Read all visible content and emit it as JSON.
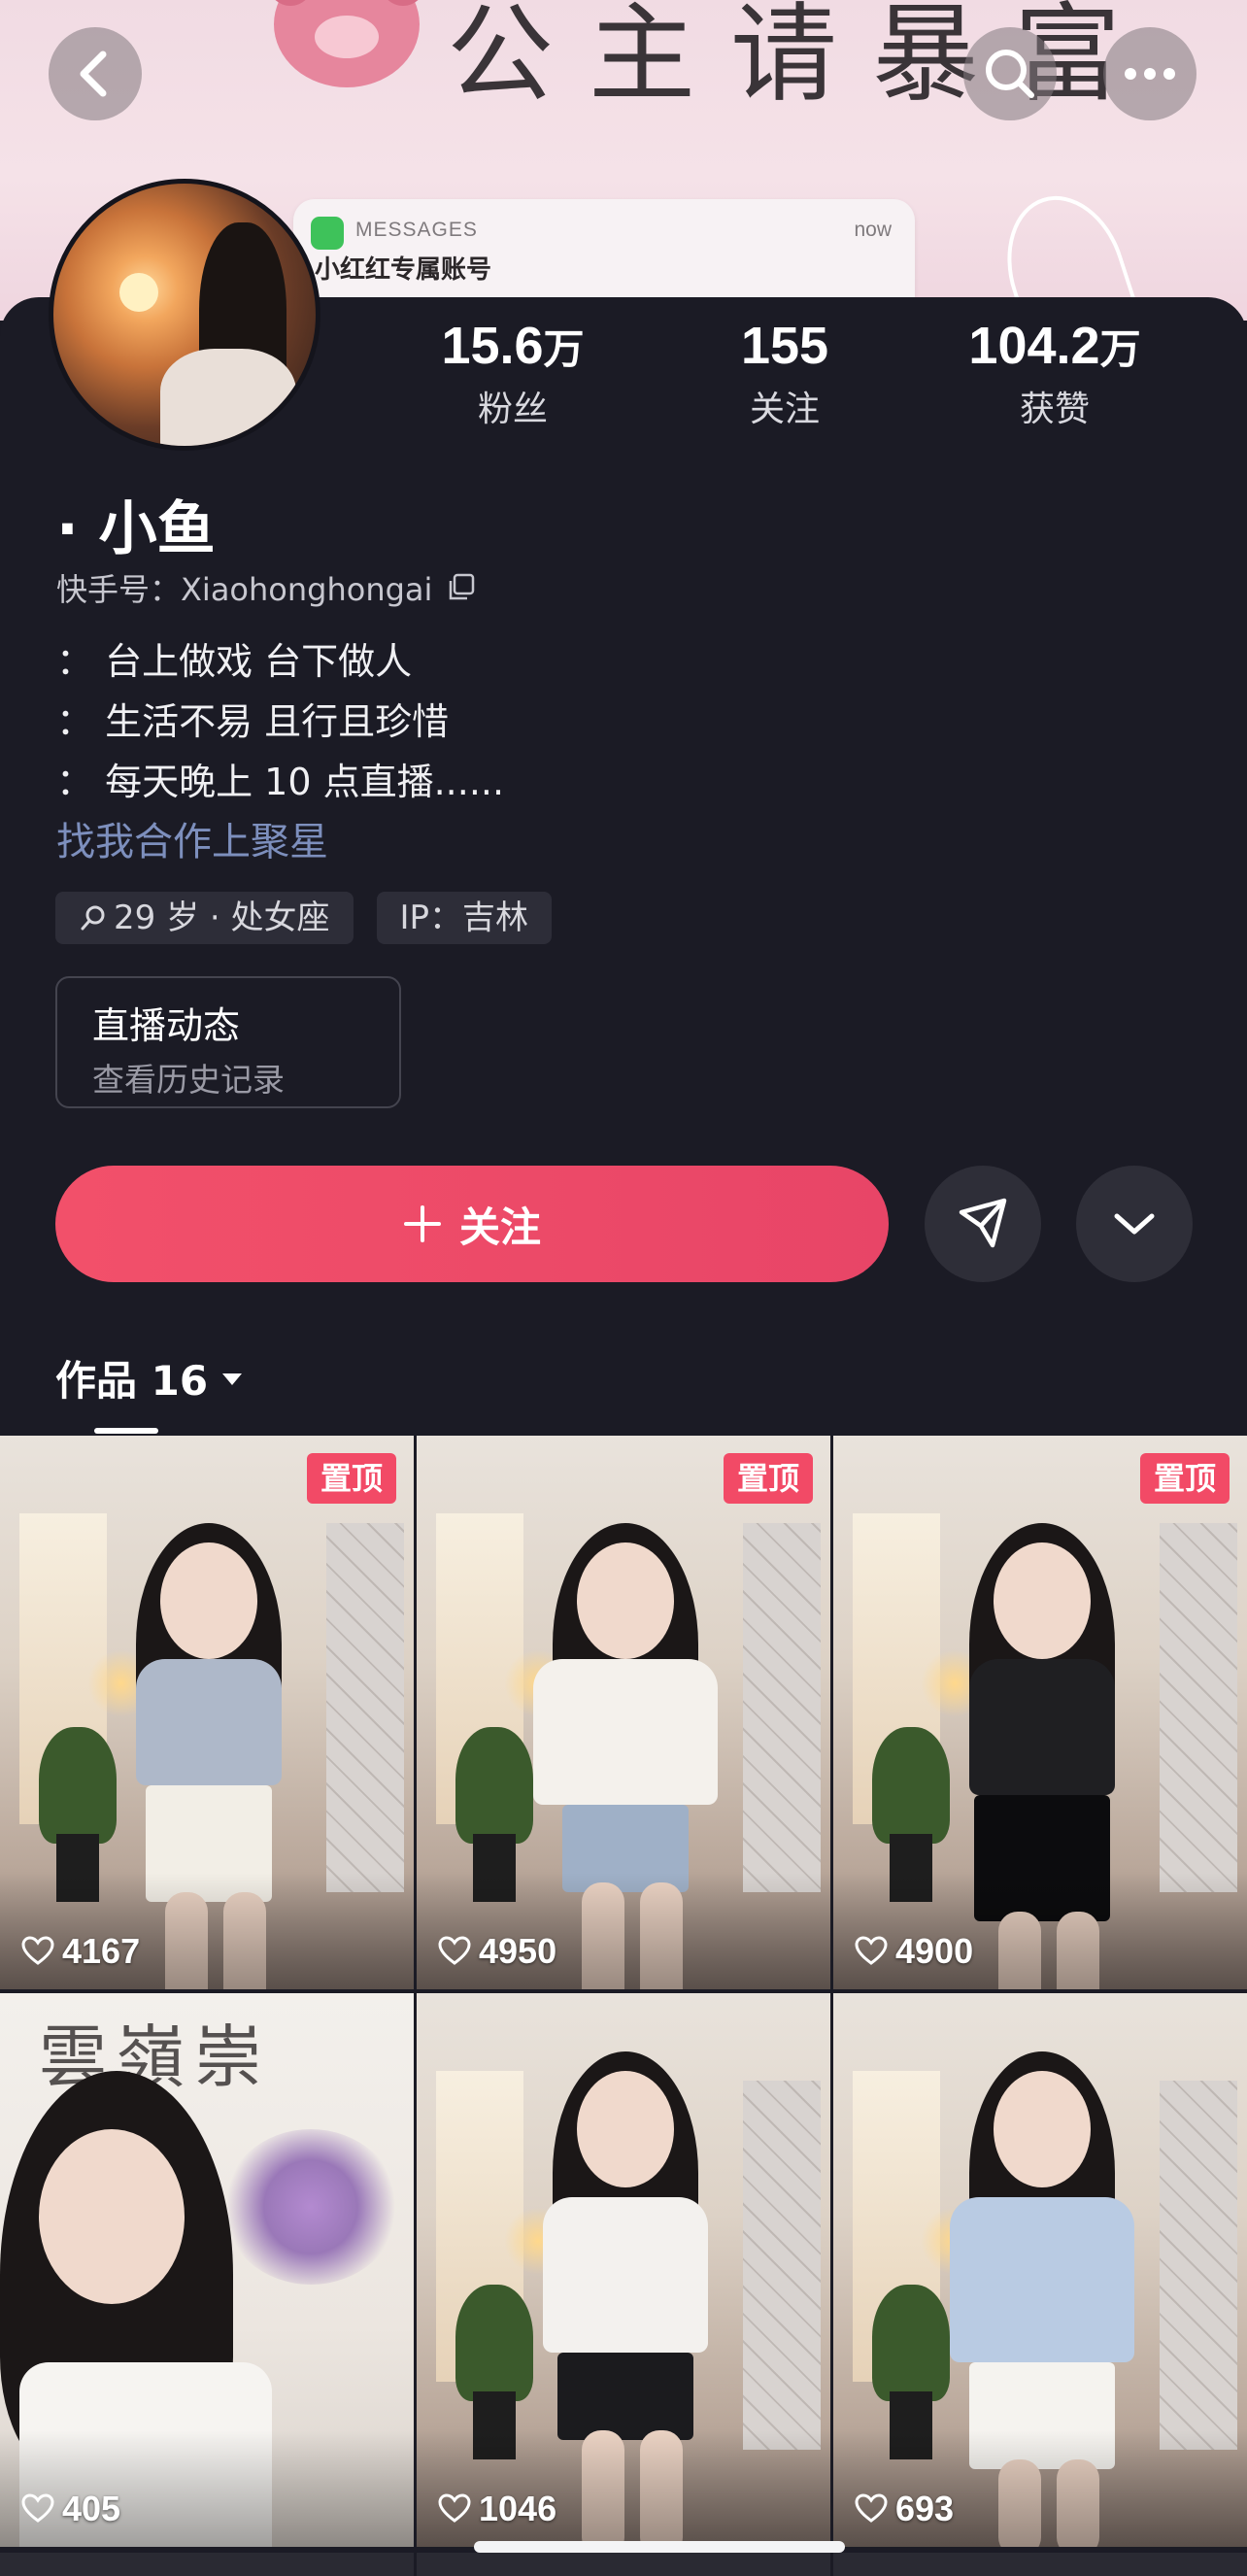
{
  "header": {
    "banner_text": "公主请暴富",
    "notification": {
      "app": "MESSAGES",
      "time": "now",
      "line1": "小红红专属账号"
    },
    "buttons": {
      "back": "back-icon",
      "search": "search-icon",
      "more": "more-icon"
    }
  },
  "profile": {
    "stats": [
      {
        "value": "15.6",
        "unit": "万",
        "label": "粉丝"
      },
      {
        "value": "155",
        "unit": "",
        "label": "关注"
      },
      {
        "value": "104.2",
        "unit": "万",
        "label": "获赞"
      }
    ],
    "name": "· 小鱼",
    "kuaishou_id": "快手号：Xiaohonghongai",
    "bio": [
      "：  台上做戏 台下做人",
      "：  生活不易 且行且珍惜",
      "：  每天晚上 10 点直播......"
    ],
    "promo_link": "找我合作上聚星",
    "tags": [
      {
        "icon": "search-icon",
        "text": "29 岁 · 处女座"
      },
      {
        "icon": "",
        "text": "IP：吉林"
      }
    ],
    "live": {
      "title": "直播动态",
      "subtitle": "查看历史记录"
    }
  },
  "actions": {
    "follow_label": "关注",
    "follow_icon": "plus-icon",
    "share_icon": "send-icon",
    "more_icon": "chevron-down-icon",
    "accent": "#ef4a68"
  },
  "works": {
    "tab_label": "作品 16",
    "pinned_label": "置顶",
    "items": [
      {
        "likes": "4167",
        "pinned": true
      },
      {
        "likes": "4950",
        "pinned": true
      },
      {
        "likes": "4900",
        "pinned": true
      },
      {
        "likes": "405",
        "pinned": false
      },
      {
        "likes": "1046",
        "pinned": false
      },
      {
        "likes": "693",
        "pinned": false
      }
    ]
  }
}
